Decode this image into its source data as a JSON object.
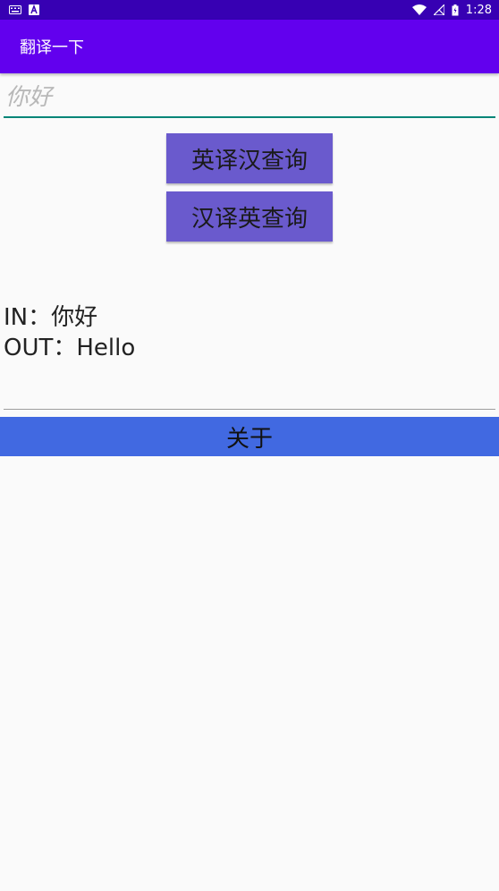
{
  "status_bar": {
    "time": "1:28",
    "icons": [
      "keyboard-icon",
      "text-a-icon",
      "wifi-icon",
      "no-signal-icon",
      "battery-charging-icon"
    ]
  },
  "app_bar": {
    "title": "翻译一下"
  },
  "input": {
    "value": "",
    "placeholder": "你好"
  },
  "buttons": {
    "en_to_zh": "英译汉查询",
    "zh_to_en": "汉译英查询",
    "about": "关于"
  },
  "result": {
    "in_line": "IN：你好",
    "out_line": "OUT：Hello"
  },
  "colors": {
    "status_bar": "#3700b3",
    "app_bar": "#6200ee",
    "input_underline": "#008577",
    "query_button": "#6a5acd",
    "about_button": "#4169e1"
  }
}
